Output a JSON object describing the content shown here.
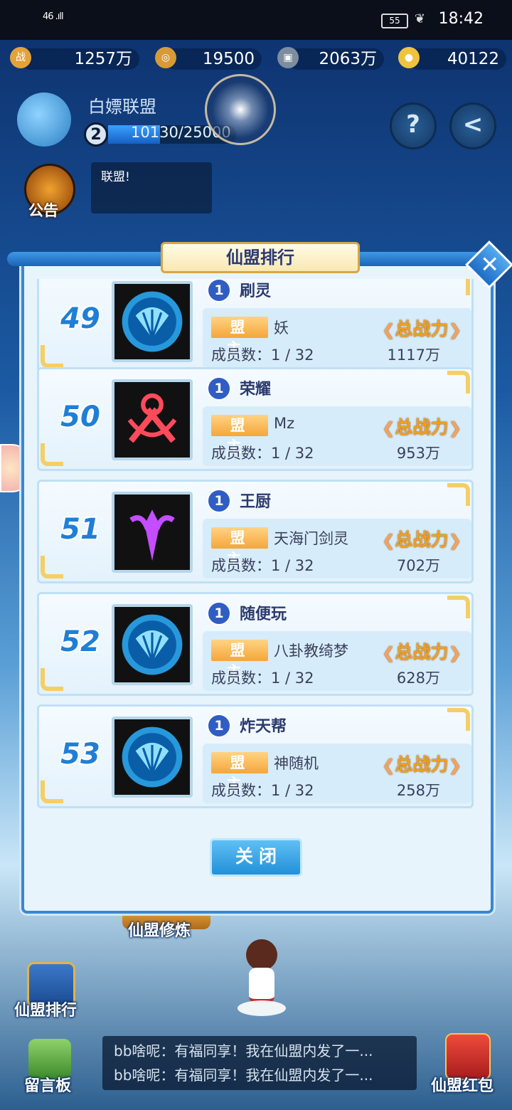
{
  "status_bar": {
    "signal": "46 .ıll",
    "battery": "55",
    "time": "18:42"
  },
  "currencies": [
    {
      "icon": "battle-power-icon",
      "glyph": "战",
      "value": "1257万",
      "color": "#e4a23a"
    },
    {
      "icon": "copper-coin-icon",
      "glyph": "◎",
      "value": "19500",
      "color": "#d79a36"
    },
    {
      "icon": "silver-coin-icon",
      "glyph": "▣",
      "value": "2063万",
      "color": "#7d8da0"
    },
    {
      "icon": "gold-ingot-icon",
      "glyph": "●",
      "value": "40122",
      "color": "#f0c23e"
    }
  ],
  "alliance": {
    "name": "白嫖联盟",
    "level": "2",
    "xp_text": "10130/25000",
    "xp_fraction": 0.405
  },
  "notice": {
    "label": "公告",
    "text": "联盟!"
  },
  "panel": {
    "title": "仙盟排行",
    "leader_tag": "盟主",
    "members_label": "成员数：",
    "power_label": "总战力",
    "close_label": "关闭",
    "close_x": "✕"
  },
  "rankings": [
    {
      "rank": "49",
      "level": "1",
      "name": "刷灵",
      "leader": "妖",
      "members": "1 / 32",
      "power": "1117万",
      "emblem": "shell",
      "emblem_color": "#2aa7f2"
    },
    {
      "rank": "50",
      "level": "1",
      "name": "荣耀",
      "leader": "Mz",
      "members": "1 / 32",
      "power": "953万",
      "emblem": "swords",
      "emblem_color": "#ff4a5c"
    },
    {
      "rank": "51",
      "level": "1",
      "name": "王厨",
      "leader": "天海门剑灵",
      "members": "1 / 32",
      "power": "702万",
      "emblem": "sword",
      "emblem_color": "#c44dff"
    },
    {
      "rank": "52",
      "level": "1",
      "name": "随便玩",
      "leader": "八卦教绮梦",
      "members": "1 / 32",
      "power": "628万",
      "emblem": "shell",
      "emblem_color": "#2aa7f2"
    },
    {
      "rank": "53",
      "level": "1",
      "name": "炸天帮",
      "leader": "神随机",
      "members": "1 / 32",
      "power": "258万",
      "emblem": "shell",
      "emblem_color": "#2aa7f2"
    }
  ],
  "background": {
    "cultivation_label": "仙盟修炼",
    "rank_label": "仙盟排行",
    "board_label": "留言板",
    "red_packet_label": "仙盟红包",
    "chat_lines": [
      "bb啥呢：有福同享！我在仙盟内发了一...",
      "bb啥呢：有福同享！我在仙盟内发了一..."
    ]
  }
}
